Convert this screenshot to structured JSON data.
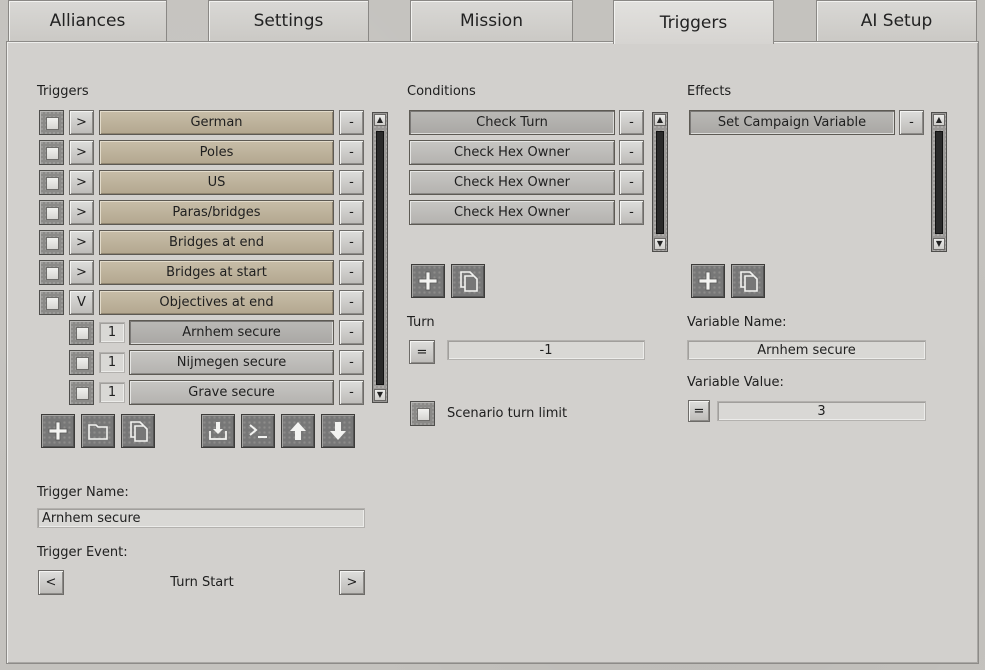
{
  "tabs": [
    "Alliances",
    "Settings",
    "Mission",
    "Triggers",
    "AI Setup"
  ],
  "active_tab": "Triggers",
  "triggers": {
    "header": "Triggers",
    "items": [
      {
        "expander": ">",
        "label": "German"
      },
      {
        "expander": ">",
        "label": "Poles"
      },
      {
        "expander": ">",
        "label": "US"
      },
      {
        "expander": ">",
        "label": "Paras/bridges"
      },
      {
        "expander": ">",
        "label": "Bridges at end"
      },
      {
        "expander": ">",
        "label": "Bridges at start"
      },
      {
        "expander": "V",
        "label": "Objectives at end"
      }
    ],
    "subitems": [
      {
        "index": "1",
        "label": "Arnhem secure"
      },
      {
        "index": "1",
        "label": "Nijmegen secure"
      },
      {
        "index": "1",
        "label": "Grave secure"
      }
    ],
    "minus_label": "-",
    "trigger_name_label": "Trigger Name:",
    "trigger_name_value": "Arnhem secure",
    "trigger_event_label": "Trigger Event:",
    "trigger_event_value": "Turn Start",
    "prev_label": "<",
    "next_label": ">"
  },
  "conditions": {
    "header": "Conditions",
    "items": [
      "Check Turn",
      "Check Hex Owner",
      "Check Hex Owner",
      "Check Hex Owner"
    ],
    "minus_label": "-",
    "turn_label": "Turn",
    "turn_operator": "=",
    "turn_value": "-1",
    "scenario_turn_limit_label": "Scenario turn limit"
  },
  "effects": {
    "header": "Effects",
    "items": [
      "Set Campaign Variable"
    ],
    "minus_label": "-",
    "variable_name_label": "Variable Name:",
    "variable_name_value": "Arnhem secure",
    "variable_value_label": "Variable Value:",
    "variable_operator": "=",
    "variable_value": "3"
  },
  "colors": {
    "trigger_row": "#bdb29b",
    "condition_row": "#bebdba",
    "background": "#c4c2be"
  },
  "icons": [
    "add-icon",
    "folder-icon",
    "copy-icon",
    "import-icon",
    "console-icon",
    "arrow-up-icon",
    "arrow-down-icon"
  ]
}
